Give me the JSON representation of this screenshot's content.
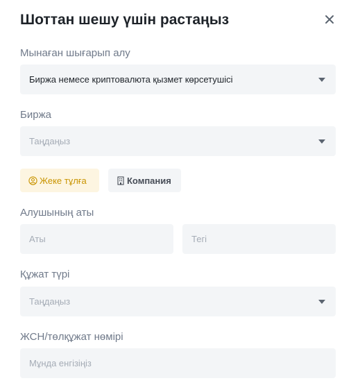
{
  "dialog": {
    "title": "Шоттан шешу үшін растаңыз"
  },
  "withdraw_from": {
    "label": "Мынаған шығарып алу",
    "value": "Биржа немесе криптовалюта қызмет көрсетушісі"
  },
  "exchange": {
    "label": "Биржа",
    "placeholder": "Таңдаңыз"
  },
  "account_type_tabs": [
    {
      "label": "Жеке тұлға",
      "icon": "user-circle-icon",
      "active": true
    },
    {
      "label": "Компания",
      "icon": "building-icon",
      "active": false
    }
  ],
  "recipient_name": {
    "label": "Алушының аты",
    "first_name_placeholder": "Аты",
    "last_name_placeholder": "Тегі"
  },
  "document_type": {
    "label": "Құжат түрі",
    "placeholder": "Таңдаңыз"
  },
  "id_number": {
    "label": "ЖСН/төлқұжат нөмірі",
    "placeholder": "Мұнда енгізіңіз"
  },
  "colors": {
    "accent": "#c99400",
    "accent_bg": "#fdf5e1",
    "field_bg": "#f3f5f7",
    "label": "#707a8a",
    "placeholder": "#a5acb6"
  }
}
